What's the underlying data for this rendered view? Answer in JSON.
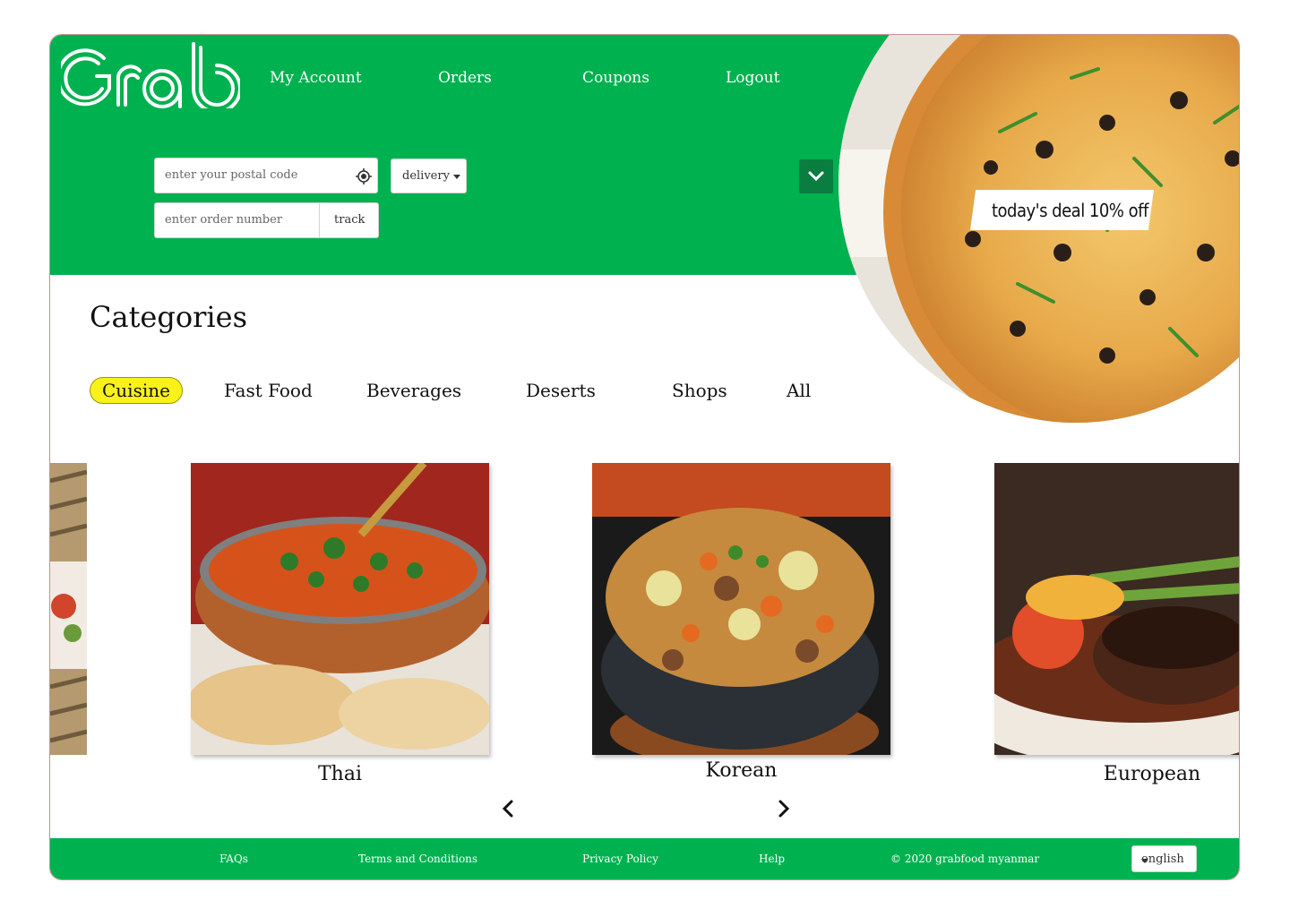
{
  "brand": {
    "logo_text": "Grab",
    "color": "#00b14f",
    "dark_accent": "#0a7d41",
    "highlight": "#f9f21a"
  },
  "nav": {
    "items": [
      "My Account",
      "Orders",
      "Coupons",
      "Logout"
    ]
  },
  "search": {
    "postal_placeholder": "enter your postal code",
    "locate_icon": "location-crosshair-icon",
    "mode_value": "delivery",
    "order_placeholder": "enter order number",
    "track_label": "track"
  },
  "promo": {
    "deal_text": "today's deal 10% off",
    "expand_icon": "chevron-down-icon"
  },
  "categories": {
    "title": "Categories",
    "tabs": [
      "Cuisine",
      "Fast Food",
      "Beverages",
      "Deserts",
      "Shops",
      "All"
    ],
    "active": "Cuisine"
  },
  "cards": [
    {
      "label": "Thai"
    },
    {
      "label": "Korean"
    },
    {
      "label": "European"
    }
  ],
  "carousel": {
    "prev_icon": "chevron-left-icon",
    "next_icon": "chevron-right-icon"
  },
  "footer": {
    "links": [
      "FAQs",
      "Terms and Conditions",
      "Privacy Policy",
      "Help"
    ],
    "copyright": "© 2020 grabfood myanmar",
    "language": "english"
  }
}
